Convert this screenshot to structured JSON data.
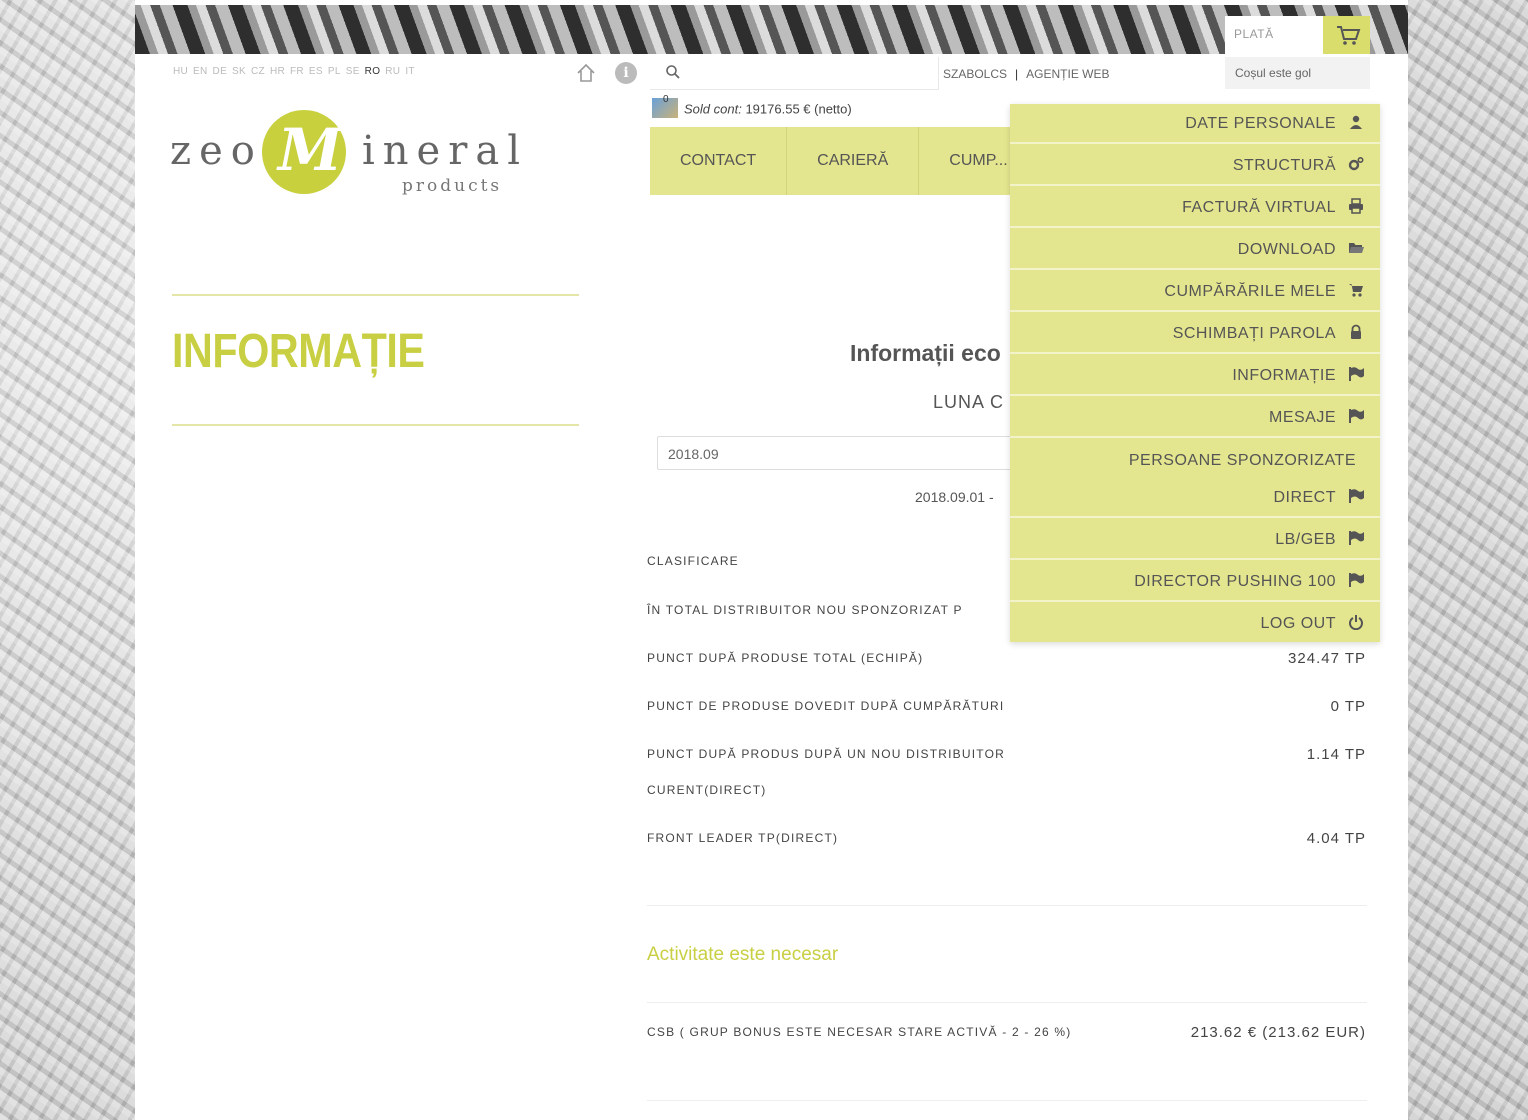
{
  "colors": {
    "accent": "#c9cf43",
    "menu_bg": "#e4e68f"
  },
  "languages": [
    "HU",
    "EN",
    "DE",
    "SK",
    "CZ",
    "HR",
    "FR",
    "ES",
    "PL",
    "SE",
    "RO",
    "RU",
    "IT"
  ],
  "active_language": "RO",
  "header": {
    "user_name": "SZABOLCS",
    "separator": "|",
    "agency_link": "AGENȚIE WEB",
    "cart_label": "PLATĂ",
    "cart_status": "Coșul este gol",
    "balance_count": "0",
    "balance_label": "Sold cont:",
    "balance_value": "19176.55 € (netto)"
  },
  "logo": {
    "part1": "zeo",
    "letter": "M",
    "part2": "ineral",
    "subtitle": "products"
  },
  "nav": {
    "items": [
      "CONTACT",
      "CARIERĂ",
      "CUMP..."
    ]
  },
  "sidebar": {
    "title": "INFORMAȚIE"
  },
  "main": {
    "title": "Informații eco",
    "month_label": "LUNA C",
    "selected_month": "2018.09",
    "date_range": "2018.09.01 -",
    "rows": [
      {
        "label": "CLASIFICARE",
        "value": ""
      },
      {
        "label": "ÎN TOTAL DISTRIBUITOR NOU SPONZORIZAT P",
        "value": ""
      },
      {
        "label": "PUNCT DUPĂ PRODUSE TOTAL (ECHIPĂ)",
        "value": "324.47 TP"
      },
      {
        "label": "PUNCT DE PRODUSE DOVEDIT DUPĂ CUMPĂRĂTURI",
        "value": "0 TP"
      },
      {
        "label": "PUNCT DUPĂ PRODUS DUPĂ UN NOU DISTRIBUITOR",
        "label2": "CURENT(DIRECT)",
        "value": "1.14 TP"
      },
      {
        "label": "FRONT LEADER TP(DIRECT)",
        "value": "4.04 TP"
      }
    ],
    "activity_title": "Activitate este necesar",
    "activity_row": {
      "label": "CSB ( GRUP BONUS ESTE NECESAR STARE ACTIVĂ - 2 - 26 %)",
      "value": "213.62 € (213.62 EUR)"
    }
  },
  "dropdown": {
    "items": [
      {
        "label": "DATE PERSONALE",
        "icon": "user-icon"
      },
      {
        "label": "STRUCTURĂ",
        "icon": "gears-icon"
      },
      {
        "label": "FACTURĂ VIRTUAL",
        "icon": "print-icon"
      },
      {
        "label": "DOWNLOAD",
        "icon": "folder-icon"
      },
      {
        "label": "CUMPĂRĂRILE MELE",
        "icon": "cart-icon"
      },
      {
        "label": "SCHIMBAȚI PAROLA",
        "icon": "lock-icon"
      },
      {
        "label": "INFORMAȚIE",
        "icon": "flag-icon"
      },
      {
        "label": "MESAJE",
        "icon": "flag-icon"
      }
    ],
    "section_header": "PERSOANE SPONZORIZATE",
    "sub_items": [
      {
        "label": "DIRECT",
        "icon": "flag-icon"
      },
      {
        "label": "LB/GEB",
        "icon": "flag-icon"
      },
      {
        "label": "DIRECTOR PUSHING 100",
        "icon": "flag-icon"
      },
      {
        "label": "LOG OUT",
        "icon": "power-icon"
      }
    ]
  }
}
